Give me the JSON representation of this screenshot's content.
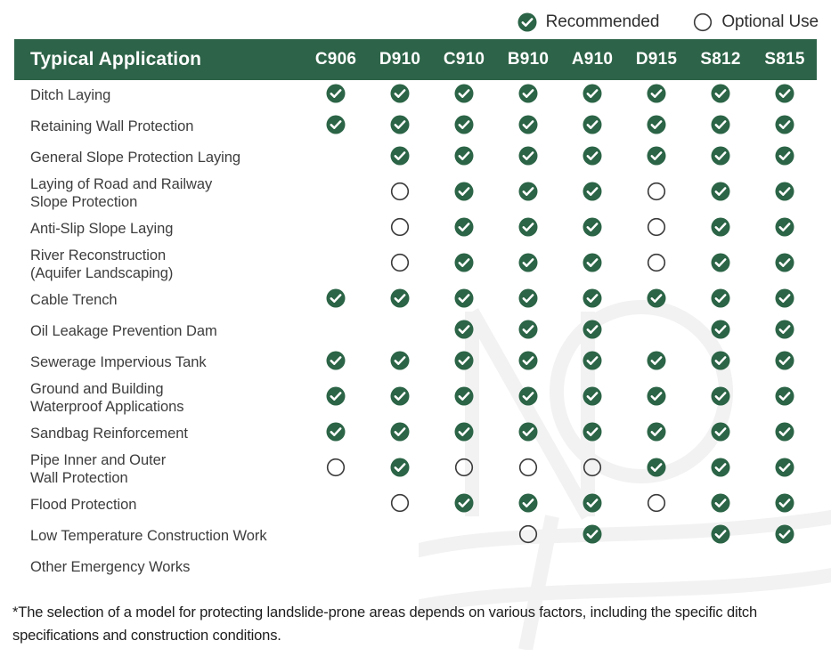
{
  "legend": {
    "items": [
      {
        "icon": "check-circle-filled-icon",
        "label": "Recommended",
        "type": "check"
      },
      {
        "icon": "circle-outline-icon",
        "label": "Optional Use",
        "type": "circle"
      }
    ]
  },
  "table": {
    "header": {
      "row_label": "Typical Application",
      "columns": [
        "C906",
        "D910",
        "C910",
        "B910",
        "A910",
        "D915",
        "S812",
        "S815"
      ]
    },
    "rows": [
      {
        "label": "Ditch Laying",
        "lines": [
          "Ditch Laying"
        ],
        "marks": [
          "check",
          "check",
          "check",
          "check",
          "check",
          "check",
          "check",
          "check"
        ]
      },
      {
        "label": "Retaining Wall Protection",
        "lines": [
          "Retaining Wall Protection"
        ],
        "marks": [
          "check",
          "check",
          "check",
          "check",
          "check",
          "check",
          "check",
          "check"
        ]
      },
      {
        "label": "General Slope Protection Laying",
        "lines": [
          "General Slope Protection Laying"
        ],
        "marks": [
          "none",
          "check",
          "check",
          "check",
          "check",
          "check",
          "check",
          "check"
        ]
      },
      {
        "label": "Laying of Road and Railway Slope Protection",
        "lines": [
          "Laying of Road and Railway",
          "Slope Protection"
        ],
        "marks": [
          "none",
          "circle",
          "check",
          "check",
          "check",
          "circle",
          "check",
          "check"
        ]
      },
      {
        "label": "Anti-Slip Slope Laying",
        "lines": [
          "Anti-Slip Slope Laying"
        ],
        "marks": [
          "none",
          "circle",
          "check",
          "check",
          "check",
          "circle",
          "check",
          "check"
        ]
      },
      {
        "label": "River Reconstruction (Aquifer Landscaping)",
        "lines": [
          "River Reconstruction",
          "(Aquifer Landscaping)"
        ],
        "marks": [
          "none",
          "circle",
          "check",
          "check",
          "check",
          "circle",
          "check",
          "check"
        ]
      },
      {
        "label": "Cable Trench",
        "lines": [
          "Cable Trench"
        ],
        "marks": [
          "check",
          "check",
          "check",
          "check",
          "check",
          "check",
          "check",
          "check"
        ]
      },
      {
        "label": "Oil Leakage Prevention Dam",
        "lines": [
          "Oil Leakage Prevention Dam"
        ],
        "marks": [
          "none",
          "none",
          "check",
          "check",
          "check",
          "none",
          "check",
          "check"
        ]
      },
      {
        "label": "Sewerage Impervious Tank",
        "lines": [
          "Sewerage Impervious Tank"
        ],
        "marks": [
          "check",
          "check",
          "check",
          "check",
          "check",
          "check",
          "check",
          "check"
        ]
      },
      {
        "label": "Ground and Building Waterproof Applications",
        "lines": [
          "Ground and Building",
          "Waterproof Applications"
        ],
        "marks": [
          "check",
          "check",
          "check",
          "check",
          "check",
          "check",
          "check",
          "check"
        ]
      },
      {
        "label": "Sandbag Reinforcement",
        "lines": [
          "Sandbag Reinforcement"
        ],
        "marks": [
          "check",
          "check",
          "check",
          "check",
          "check",
          "check",
          "check",
          "check"
        ]
      },
      {
        "label": "Pipe Inner and Outer Wall Protection",
        "lines": [
          "Pipe Inner and Outer",
          "Wall Protection"
        ],
        "marks": [
          "circle",
          "check",
          "circle",
          "circle",
          "circle",
          "check",
          "check",
          "check"
        ]
      },
      {
        "label": "Flood Protection",
        "lines": [
          "Flood Protection"
        ],
        "marks": [
          "none",
          "circle",
          "check",
          "check",
          "check",
          "circle",
          "check",
          "check"
        ]
      },
      {
        "label": "Low Temperature Construction Work",
        "lines": [
          "Low Temperature Construction Work"
        ],
        "marks": [
          "none",
          "none",
          "none",
          "circle",
          "check",
          "none",
          "check",
          "check"
        ]
      },
      {
        "label": "Other Emergency Works",
        "lines": [
          "Other Emergency Works"
        ],
        "marks": [
          "none",
          "none",
          "none",
          "none",
          "none",
          "none",
          "none",
          "none"
        ]
      }
    ]
  },
  "footnote": {
    "text": "*The selection of a model for protecting landslide-prone areas depends on various factors, including the specific ditch specifications and construction conditions."
  },
  "colors": {
    "header_green": "#2d6348",
    "mark_green": "#2b6446",
    "circle_stroke": "#3a3a3a",
    "text": "#3d3d3d"
  }
}
